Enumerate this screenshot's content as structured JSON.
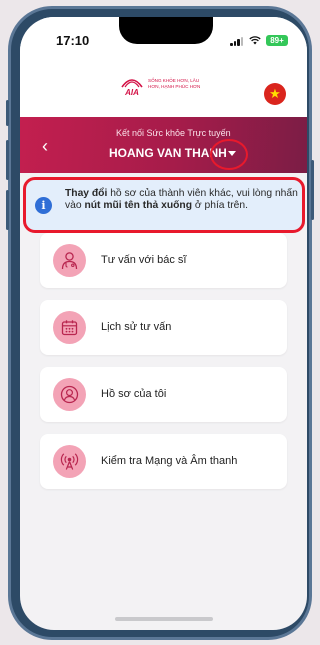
{
  "status_bar": {
    "time": "17:10",
    "battery": "89+"
  },
  "brand": {
    "logo_text": "AIA",
    "tagline": "SỐNG KHỎE HƠN, LÂU HƠN, HẠNH PHÚC HƠN"
  },
  "header": {
    "subtitle": "Kết nối Sức khỏe Trực tuyến",
    "member_name": "HOANG VAN THANH",
    "back_glyph": "‹",
    "language_flag": "★"
  },
  "info": {
    "icon_glyph": "i",
    "bold_1": "Thay đổi",
    "text_1": " hồ sơ của thành viên khác, vui lòng nhấn vào ",
    "bold_2": "nút mũi tên thả xuống",
    "text_2": " ở phía trên."
  },
  "menu": [
    {
      "label": "Tư vấn với bác sĩ",
      "icon": "doctor-icon"
    },
    {
      "label": "Lịch sử tư vấn",
      "icon": "calendar-icon"
    },
    {
      "label": "Hồ sơ của tôi",
      "icon": "profile-icon"
    },
    {
      "label": "Kiểm tra Mạng và Âm thanh",
      "icon": "network-icon"
    }
  ],
  "colors": {
    "brand_red": "#d31145",
    "highlight_red": "#e8192c",
    "info_bg": "#e3eefb",
    "icon_bg": "#f3a3b6"
  }
}
